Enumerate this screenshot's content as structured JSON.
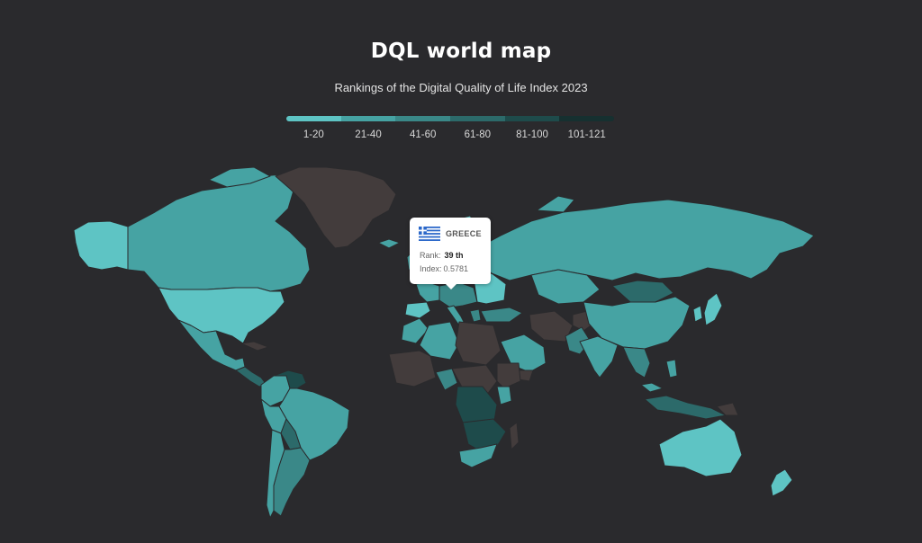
{
  "header": {
    "title": "DQL world map",
    "subtitle": "Rankings of the Digital Quality of Life Index 2023"
  },
  "legend": {
    "items": [
      {
        "label": "1-20",
        "color": "#5ec4c4"
      },
      {
        "label": "21-40",
        "color": "#46a3a3"
      },
      {
        "label": "41-60",
        "color": "#3a8888"
      },
      {
        "label": "61-80",
        "color": "#2c6a6a"
      },
      {
        "label": "81-100",
        "color": "#1e4b4b"
      },
      {
        "label": "101-121",
        "color": "#163030"
      }
    ]
  },
  "colors": {
    "background": "#2a2a2d",
    "no_data": "#433c3c",
    "tier_1": "#5ec4c4",
    "tier_2": "#46a3a3",
    "tier_3": "#3a8888",
    "tier_4": "#2c6a6a",
    "tier_5": "#1e4b4b",
    "tier_6": "#163030"
  },
  "tooltip": {
    "country": "GREECE",
    "rank_label": "Rank:",
    "rank_value": "39 th",
    "index_label": "Index:",
    "index_value": "0.5781",
    "flag_icon": "greece-flag-icon"
  }
}
